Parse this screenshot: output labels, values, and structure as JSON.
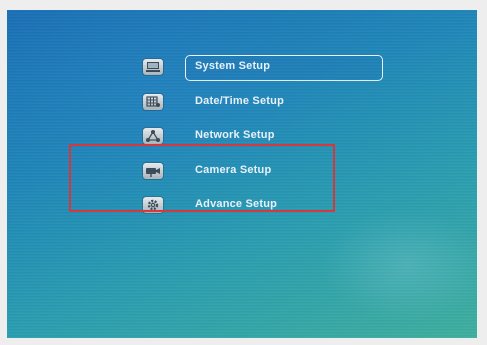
{
  "menu": {
    "items": [
      {
        "label": "System Setup",
        "icon": "monitor-icon",
        "selected": true
      },
      {
        "label": "Date/Time Setup",
        "icon": "calendar-grid-icon",
        "selected": false
      },
      {
        "label": "Network Setup",
        "icon": "network-icon",
        "selected": false
      },
      {
        "label": "Camera Setup",
        "icon": "camera-icon",
        "selected": false
      },
      {
        "label": "Advance Setup",
        "icon": "gear-icon",
        "selected": false
      }
    ]
  },
  "colors": {
    "screen_background": "#1f86b8",
    "label_text": "#e9f3fb",
    "annotation_box": "#d8343a"
  }
}
